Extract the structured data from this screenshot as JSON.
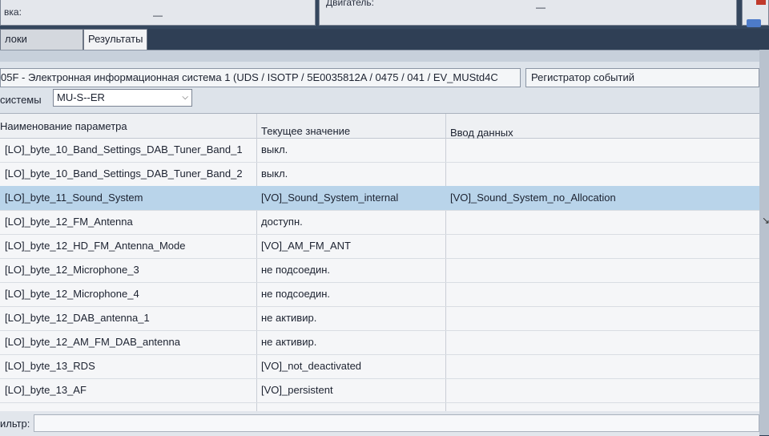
{
  "top": {
    "left_label": "вка:",
    "left_value": "—",
    "right_label": "Двигатель:",
    "right_value": "—"
  },
  "tabs": [
    {
      "label": "локи управления"
    },
    {
      "label": "Результаты"
    }
  ],
  "ecu": {
    "title": "05F - Электронная информационная система 1   (UDS / ISOTP / 5E0035812A  / 0475 / 041 / EV_MUStd4C",
    "event_button": "Регистратор событий"
  },
  "system": {
    "label": "системы",
    "selected": "MU-S--ER"
  },
  "table": {
    "headers": [
      "Наименование параметра",
      "Текущее значение",
      "Ввод данных"
    ],
    "rows": [
      {
        "name": "[LO]_byte_10_Band_Settings_DAB_Tuner_Band_1",
        "value": "выкл.",
        "input": ""
      },
      {
        "name": "[LO]_byte_10_Band_Settings_DAB_Tuner_Band_2",
        "value": "выкл.",
        "input": ""
      },
      {
        "name": "[LO]_byte_11_Sound_System",
        "value": "[VO]_Sound_System_internal",
        "input": "[VO]_Sound_System_no_Allocation"
      },
      {
        "name": "[LO]_byte_12_FM_Antenna",
        "value": "доступн.",
        "input": ""
      },
      {
        "name": "[LO]_byte_12_HD_FM_Antenna_Mode",
        "value": "[VO]_AM_FM_ANT",
        "input": ""
      },
      {
        "name": "[LO]_byte_12_Microphone_3",
        "value": "не подсоедин.",
        "input": ""
      },
      {
        "name": "[LO]_byte_12_Microphone_4",
        "value": "не подсоедин.",
        "input": ""
      },
      {
        "name": "[LO]_byte_12_DAB_antenna_1",
        "value": "не активир.",
        "input": ""
      },
      {
        "name": "[LO]_byte_12_AM_FM_DAB_antenna",
        "value": "не активир.",
        "input": ""
      },
      {
        "name": "[LO]_byte_13_RDS",
        "value": "[VO]_not_deactivated",
        "input": ""
      },
      {
        "name": "[LO]_byte_13_AF",
        "value": "[VO]_persistent",
        "input": ""
      }
    ]
  },
  "filter": {
    "label": "ильтр:",
    "value": ""
  },
  "colors": {
    "selected_row": "#b9d4ea",
    "background": "#2f3f55"
  }
}
